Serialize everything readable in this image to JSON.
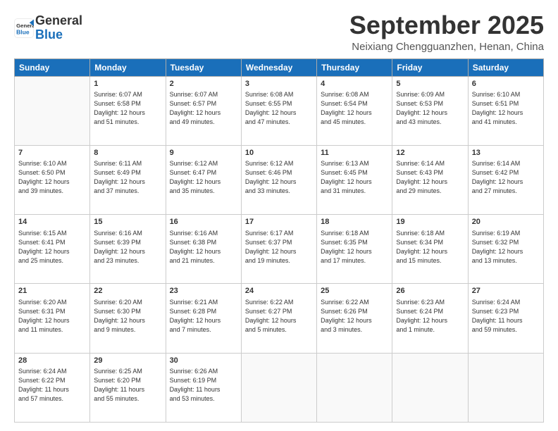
{
  "header": {
    "logo_line1": "General",
    "logo_line2": "Blue",
    "month": "September 2025",
    "location": "Neixiang Chengguanzhen, Henan, China"
  },
  "columns": [
    "Sunday",
    "Monday",
    "Tuesday",
    "Wednesday",
    "Thursday",
    "Friday",
    "Saturday"
  ],
  "weeks": [
    [
      {
        "day": "",
        "content": ""
      },
      {
        "day": "1",
        "content": "Sunrise: 6:07 AM\nSunset: 6:58 PM\nDaylight: 12 hours\nand 51 minutes."
      },
      {
        "day": "2",
        "content": "Sunrise: 6:07 AM\nSunset: 6:57 PM\nDaylight: 12 hours\nand 49 minutes."
      },
      {
        "day": "3",
        "content": "Sunrise: 6:08 AM\nSunset: 6:55 PM\nDaylight: 12 hours\nand 47 minutes."
      },
      {
        "day": "4",
        "content": "Sunrise: 6:08 AM\nSunset: 6:54 PM\nDaylight: 12 hours\nand 45 minutes."
      },
      {
        "day": "5",
        "content": "Sunrise: 6:09 AM\nSunset: 6:53 PM\nDaylight: 12 hours\nand 43 minutes."
      },
      {
        "day": "6",
        "content": "Sunrise: 6:10 AM\nSunset: 6:51 PM\nDaylight: 12 hours\nand 41 minutes."
      }
    ],
    [
      {
        "day": "7",
        "content": "Sunrise: 6:10 AM\nSunset: 6:50 PM\nDaylight: 12 hours\nand 39 minutes."
      },
      {
        "day": "8",
        "content": "Sunrise: 6:11 AM\nSunset: 6:49 PM\nDaylight: 12 hours\nand 37 minutes."
      },
      {
        "day": "9",
        "content": "Sunrise: 6:12 AM\nSunset: 6:47 PM\nDaylight: 12 hours\nand 35 minutes."
      },
      {
        "day": "10",
        "content": "Sunrise: 6:12 AM\nSunset: 6:46 PM\nDaylight: 12 hours\nand 33 minutes."
      },
      {
        "day": "11",
        "content": "Sunrise: 6:13 AM\nSunset: 6:45 PM\nDaylight: 12 hours\nand 31 minutes."
      },
      {
        "day": "12",
        "content": "Sunrise: 6:14 AM\nSunset: 6:43 PM\nDaylight: 12 hours\nand 29 minutes."
      },
      {
        "day": "13",
        "content": "Sunrise: 6:14 AM\nSunset: 6:42 PM\nDaylight: 12 hours\nand 27 minutes."
      }
    ],
    [
      {
        "day": "14",
        "content": "Sunrise: 6:15 AM\nSunset: 6:41 PM\nDaylight: 12 hours\nand 25 minutes."
      },
      {
        "day": "15",
        "content": "Sunrise: 6:16 AM\nSunset: 6:39 PM\nDaylight: 12 hours\nand 23 minutes."
      },
      {
        "day": "16",
        "content": "Sunrise: 6:16 AM\nSunset: 6:38 PM\nDaylight: 12 hours\nand 21 minutes."
      },
      {
        "day": "17",
        "content": "Sunrise: 6:17 AM\nSunset: 6:37 PM\nDaylight: 12 hours\nand 19 minutes."
      },
      {
        "day": "18",
        "content": "Sunrise: 6:18 AM\nSunset: 6:35 PM\nDaylight: 12 hours\nand 17 minutes."
      },
      {
        "day": "19",
        "content": "Sunrise: 6:18 AM\nSunset: 6:34 PM\nDaylight: 12 hours\nand 15 minutes."
      },
      {
        "day": "20",
        "content": "Sunrise: 6:19 AM\nSunset: 6:32 PM\nDaylight: 12 hours\nand 13 minutes."
      }
    ],
    [
      {
        "day": "21",
        "content": "Sunrise: 6:20 AM\nSunset: 6:31 PM\nDaylight: 12 hours\nand 11 minutes."
      },
      {
        "day": "22",
        "content": "Sunrise: 6:20 AM\nSunset: 6:30 PM\nDaylight: 12 hours\nand 9 minutes."
      },
      {
        "day": "23",
        "content": "Sunrise: 6:21 AM\nSunset: 6:28 PM\nDaylight: 12 hours\nand 7 minutes."
      },
      {
        "day": "24",
        "content": "Sunrise: 6:22 AM\nSunset: 6:27 PM\nDaylight: 12 hours\nand 5 minutes."
      },
      {
        "day": "25",
        "content": "Sunrise: 6:22 AM\nSunset: 6:26 PM\nDaylight: 12 hours\nand 3 minutes."
      },
      {
        "day": "26",
        "content": "Sunrise: 6:23 AM\nSunset: 6:24 PM\nDaylight: 12 hours\nand 1 minute."
      },
      {
        "day": "27",
        "content": "Sunrise: 6:24 AM\nSunset: 6:23 PM\nDaylight: 11 hours\nand 59 minutes."
      }
    ],
    [
      {
        "day": "28",
        "content": "Sunrise: 6:24 AM\nSunset: 6:22 PM\nDaylight: 11 hours\nand 57 minutes."
      },
      {
        "day": "29",
        "content": "Sunrise: 6:25 AM\nSunset: 6:20 PM\nDaylight: 11 hours\nand 55 minutes."
      },
      {
        "day": "30",
        "content": "Sunrise: 6:26 AM\nSunset: 6:19 PM\nDaylight: 11 hours\nand 53 minutes."
      },
      {
        "day": "",
        "content": ""
      },
      {
        "day": "",
        "content": ""
      },
      {
        "day": "",
        "content": ""
      },
      {
        "day": "",
        "content": ""
      }
    ]
  ]
}
